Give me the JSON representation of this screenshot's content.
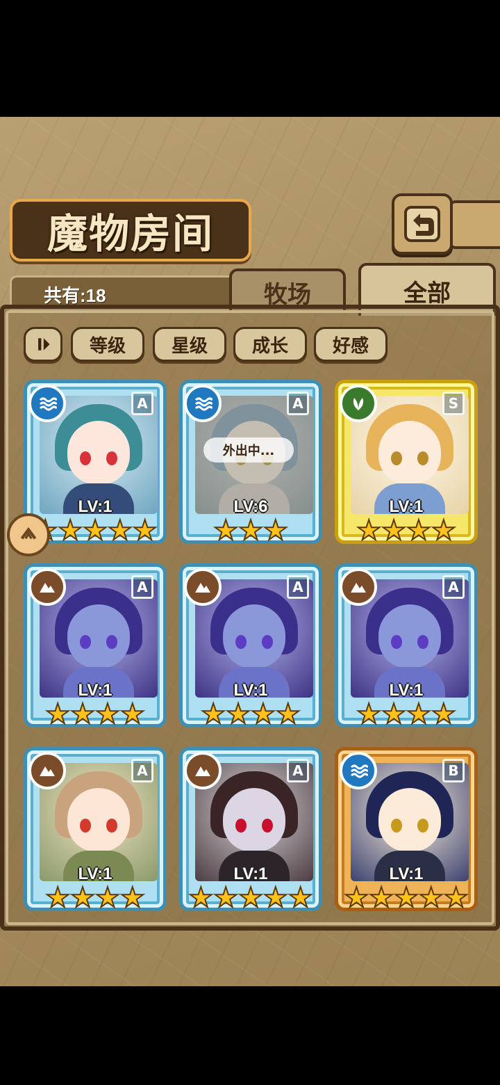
{
  "header": {
    "title": "魔物房间",
    "count_label": "共有:18"
  },
  "tabs": [
    {
      "label": "牧场"
    },
    {
      "label": "全部"
    }
  ],
  "filters": [
    {
      "label": "等级"
    },
    {
      "label": "星级"
    },
    {
      "label": "成长"
    },
    {
      "label": "好感"
    }
  ],
  "monsters": [
    {
      "rank": "A",
      "element": "water",
      "level": "LV:1",
      "stars": 5,
      "frame": "blue"
    },
    {
      "rank": "A",
      "element": "water",
      "level": "LV:6",
      "stars": 3,
      "frame": "blue",
      "status": "外出中..."
    },
    {
      "rank": "S",
      "element": "leaf",
      "level": "LV:1",
      "stars": 4,
      "frame": "gold"
    },
    {
      "rank": "A",
      "element": "earth",
      "level": "LV:1",
      "stars": 4,
      "frame": "blue"
    },
    {
      "rank": "A",
      "element": "earth",
      "level": "LV:1",
      "stars": 4,
      "frame": "blue"
    },
    {
      "rank": "A",
      "element": "earth",
      "level": "LV:1",
      "stars": 4,
      "frame": "blue"
    },
    {
      "rank": "A",
      "element": "earth",
      "level": "LV:1",
      "stars": 4,
      "frame": "blue"
    },
    {
      "rank": "A",
      "element": "earth",
      "level": "LV:1",
      "stars": 5,
      "frame": "blue"
    },
    {
      "rank": "B",
      "element": "water",
      "level": "LV:1",
      "stars": 5,
      "frame": "bronze"
    }
  ],
  "icons": {
    "back": "back-arrow-icon",
    "sort": "sort-toggle-icon",
    "lock": "lock-icon"
  },
  "colors": {
    "accent": "#e9a94b",
    "star": "#ffc21a",
    "frame_blue": "#3f8fb5",
    "frame_gold": "#c9a10f",
    "frame_bronze": "#a85f14"
  }
}
